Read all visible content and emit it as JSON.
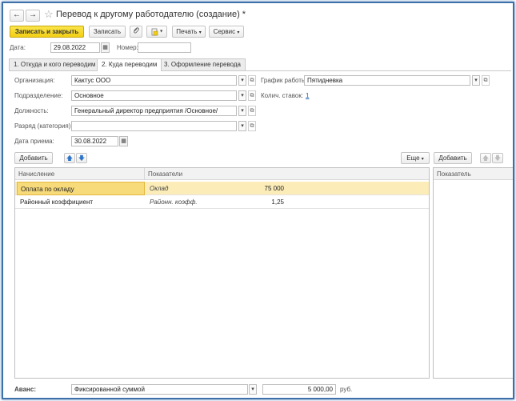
{
  "window": {
    "title": "Перевод к другому работодателю (создание) *"
  },
  "nav": {
    "back": "←",
    "forward": "→",
    "star": "☆"
  },
  "toolbar": {
    "save_close": "Записать и закрыть",
    "save": "Записать",
    "print": "Печать",
    "service": "Сервис",
    "clip_icon": "paperclip-icon",
    "doc_icon": "document-icon"
  },
  "header": {
    "date_label": "Дата:",
    "date_value": "29.08.2022",
    "number_label": "Номер:",
    "number_value": ""
  },
  "tabs": [
    {
      "label": "1. Откуда и кого переводим",
      "active": false
    },
    {
      "label": "2. Куда переводим",
      "active": true
    },
    {
      "label": "3. Оформление перевода",
      "active": false
    }
  ],
  "form": {
    "org_label": "Организация:",
    "org_value": "Кактус ООО",
    "dept_label": "Подразделение:",
    "dept_value": "Основное",
    "position_label": "Должность:",
    "position_value": "Генеральный директор предприятия /Основное/",
    "grade_label": "Разряд (категория):",
    "grade_value": "",
    "hire_label": "Дата приема:",
    "hire_value": "30.08.2022",
    "schedule_label": "График работы:",
    "schedule_value": "Пятидневка",
    "rates_label": "Колич. ставок:",
    "rates_value": "1"
  },
  "accruals": {
    "add_button": "Добавить",
    "more_button": "Еще",
    "columns": [
      "Начисление",
      "Показатели"
    ],
    "rows": [
      {
        "name": "Оплата по окладу",
        "indicator": "Оклад",
        "value": "75 000"
      },
      {
        "name": "Районный коэффициент",
        "indicator": "Районн. коэфф.",
        "value": "1,25"
      }
    ]
  },
  "indicators": {
    "add_button": "Добавить",
    "column": "Показатель"
  },
  "advance": {
    "label": "Аванс:",
    "type_value": "Фиксированной суммой",
    "amount": "5 000,00",
    "unit": "руб."
  },
  "colors": {
    "primary_button": "#f3cf14",
    "selected_row": "#fbecb8",
    "frame": "#3d6fa8",
    "arrow": "#2f74c8"
  }
}
